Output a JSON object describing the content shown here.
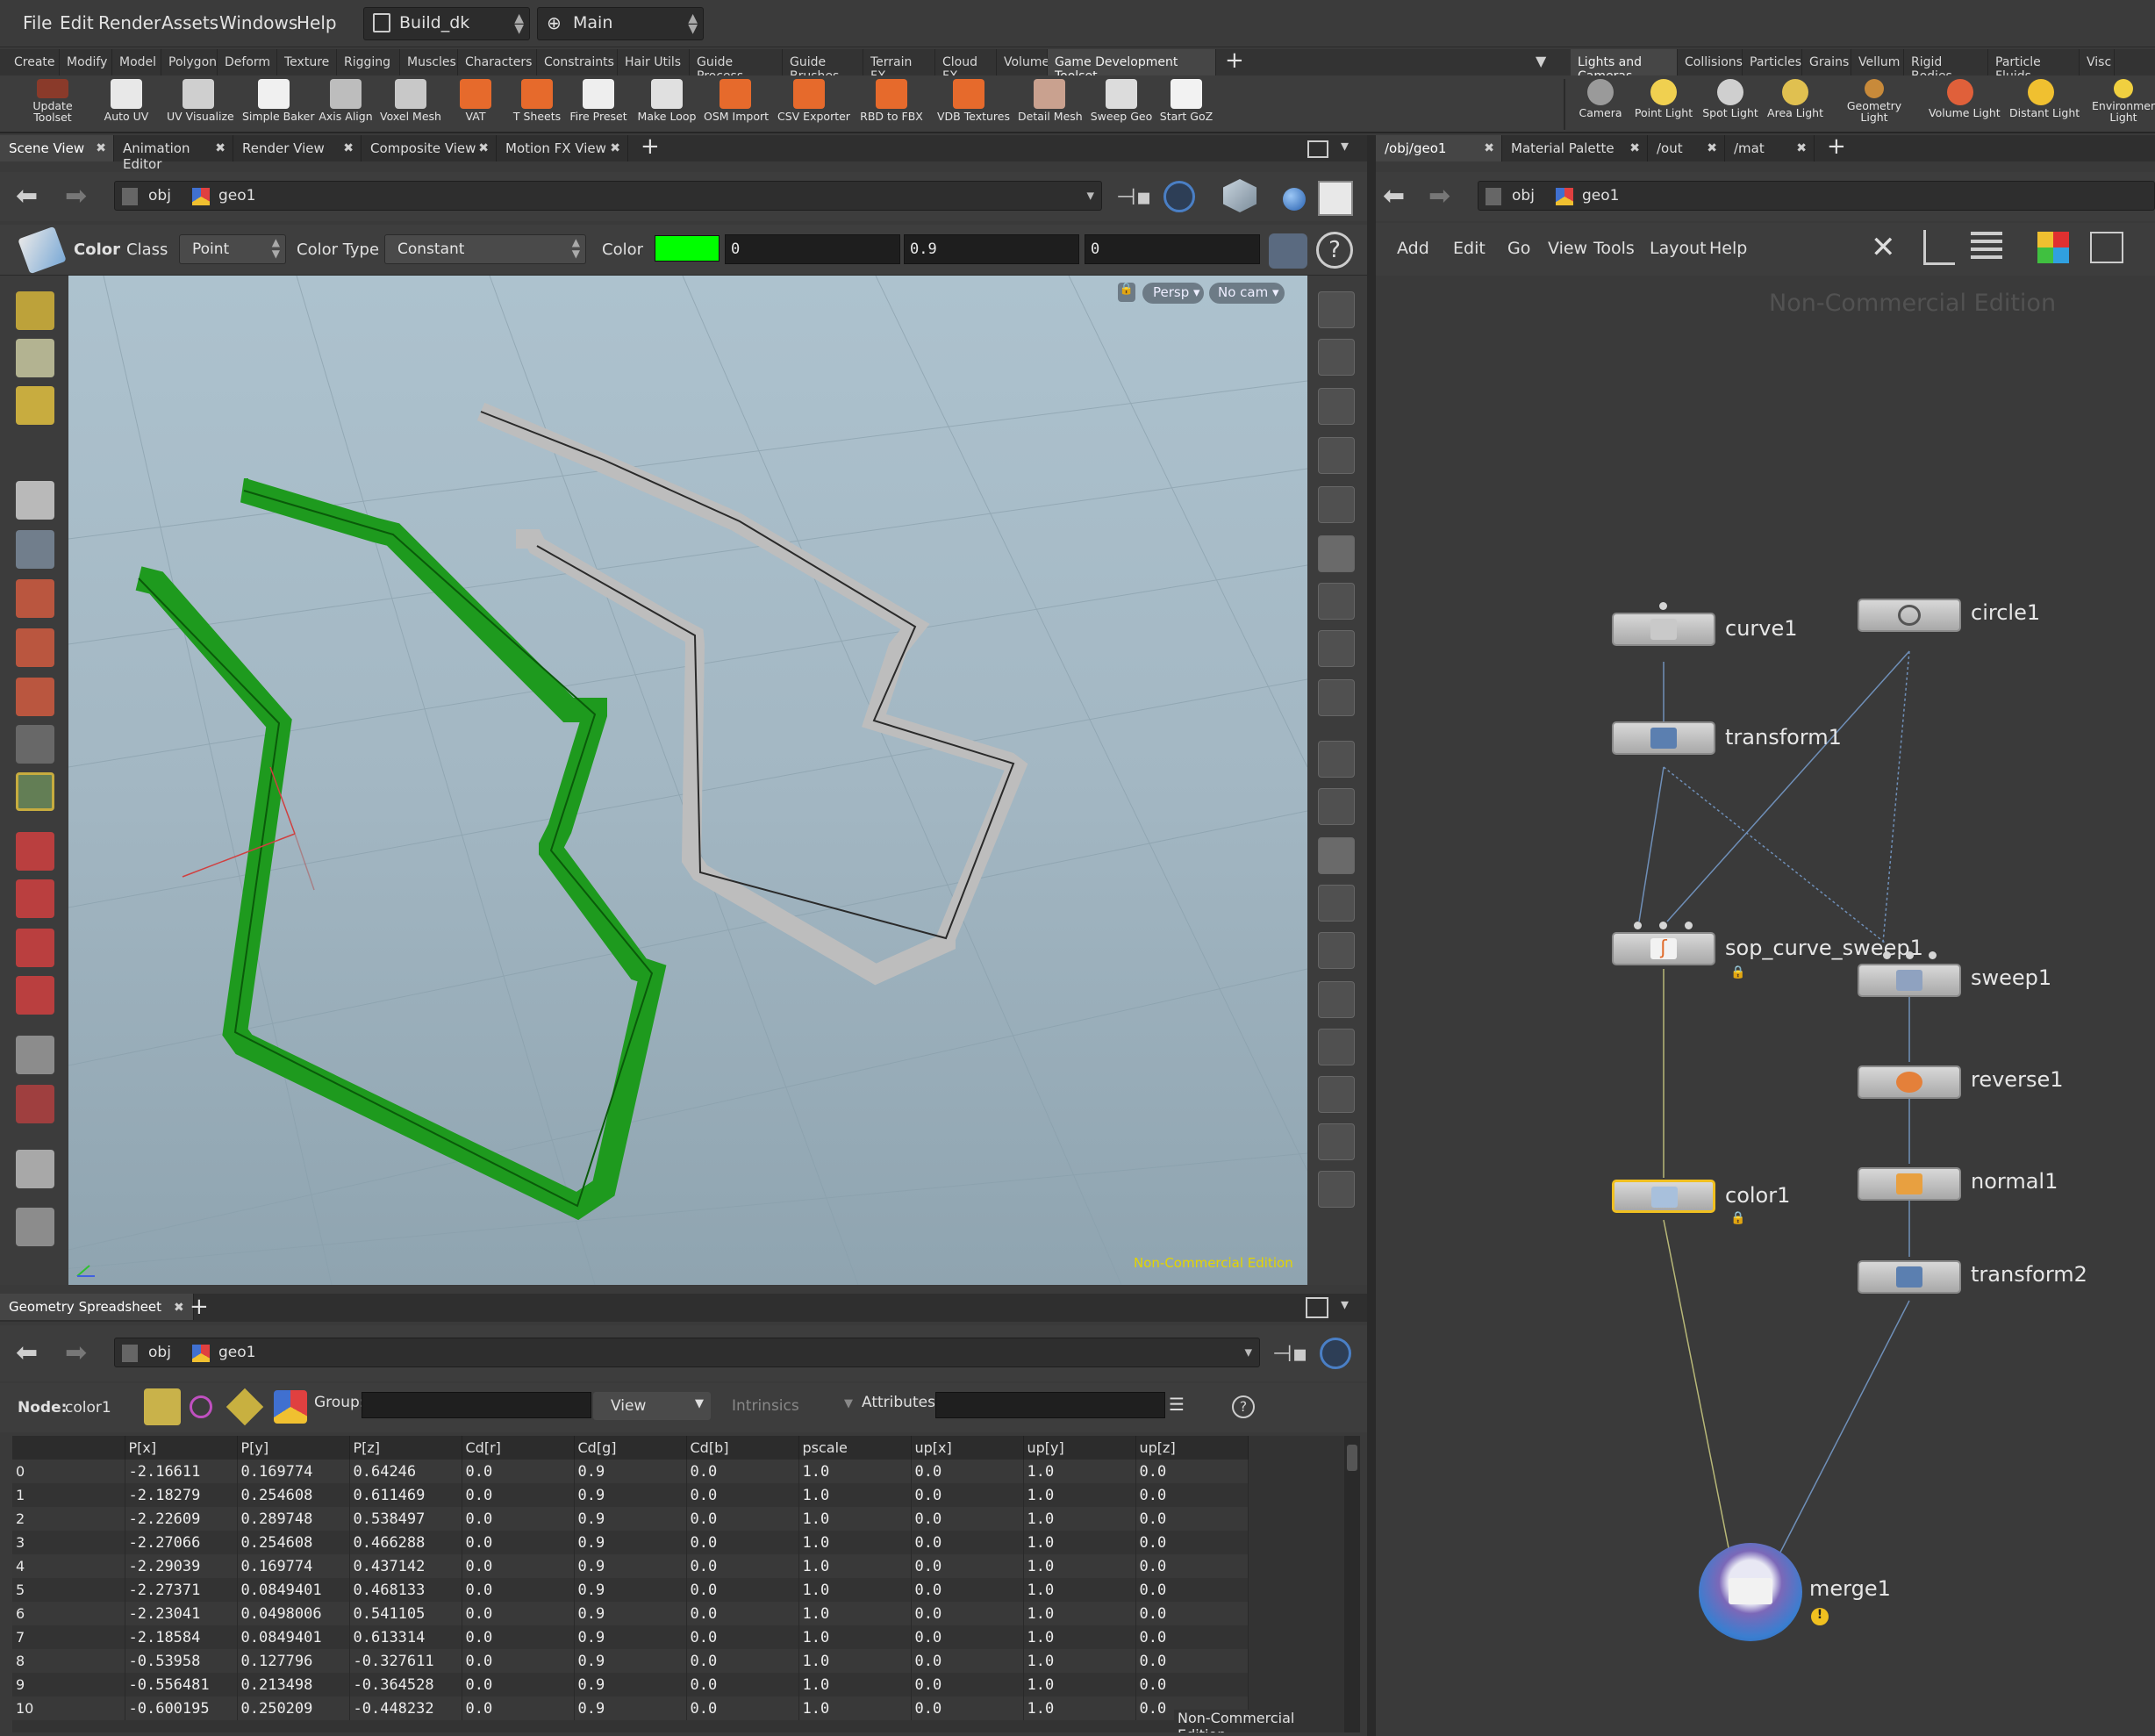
{
  "menubar": {
    "items": [
      "File",
      "Edit",
      "Render",
      "Assets",
      "Windows",
      "Help"
    ],
    "desktop": "Build_dk",
    "context": "Main"
  },
  "shelf_tabs_left": [
    "Create",
    "Modify",
    "Model",
    "Polygon",
    "Deform",
    "Texture",
    "Rigging",
    "Muscles",
    "Characters",
    "Constraints",
    "Hair Utils",
    "Guide Process",
    "Guide Brushes",
    "Terrain FX",
    "Cloud FX",
    "Volume",
    "Game Development Toolset"
  ],
  "shelf_tabs_right": [
    "Lights and Cameras",
    "Collisions",
    "Particles",
    "Grains",
    "Vellum",
    "Rigid Bodies",
    "Particle Fluids",
    "Visc"
  ],
  "shelf_tools_left": [
    {
      "label": "Update\nToolset",
      "icon": "update-toolset-icon",
      "color": "#8a3a2a"
    },
    {
      "label": "Auto UV",
      "icon": "auto-uv-icon",
      "color": "#e8e8e8"
    },
    {
      "label": "UV Visualize",
      "icon": "uv-visualize-icon",
      "color": "#cfcfcf"
    },
    {
      "label": "Simple Baker",
      "icon": "simple-baker-icon",
      "color": "#f0f0f0"
    },
    {
      "label": "Axis Align",
      "icon": "axis-align-icon",
      "color": "#bdbdbd"
    },
    {
      "label": "Voxel Mesh",
      "icon": "voxel-mesh-icon",
      "color": "#c8c8c8"
    },
    {
      "label": "VAT",
      "icon": "vat-icon",
      "color": "#e66a2c"
    },
    {
      "label": "T Sheets",
      "icon": "t-sheets-icon",
      "color": "#e66a2c"
    },
    {
      "label": "Fire Preset",
      "icon": "fire-preset-icon",
      "color": "#eeeeee"
    },
    {
      "label": "Make Loop",
      "icon": "make-loop-icon",
      "color": "#e0e0e0"
    },
    {
      "label": "OSM Import",
      "icon": "osm-import-icon",
      "color": "#e66a2c"
    },
    {
      "label": "CSV Exporter",
      "icon": "csv-exporter-icon",
      "color": "#e66a2c"
    },
    {
      "label": "RBD to FBX",
      "icon": "rbd-to-fbx-icon",
      "color": "#e66a2c"
    },
    {
      "label": "VDB Textures",
      "icon": "vdb-textures-icon",
      "color": "#e66a2c"
    },
    {
      "label": "Detail Mesh",
      "icon": "detail-mesh-icon",
      "color": "#c9a18f"
    },
    {
      "label": "Sweep Geo",
      "icon": "sweep-geo-icon",
      "color": "#dcdcdc"
    },
    {
      "label": "Start GoZ",
      "icon": "start-goz-icon",
      "color": "#f2f2f2"
    }
  ],
  "shelf_tools_right": [
    {
      "label": "Camera",
      "icon": "camera-icon",
      "color": "#9a9a9a"
    },
    {
      "label": "Point Light",
      "icon": "point-light-icon",
      "color": "#f0d050"
    },
    {
      "label": "Spot Light",
      "icon": "spot-light-icon",
      "color": "#cfcfcf"
    },
    {
      "label": "Area Light",
      "icon": "area-light-icon",
      "color": "#e0c050"
    },
    {
      "label": "Geometry\nLight",
      "icon": "geometry-light-icon",
      "color": "#c88a3a"
    },
    {
      "label": "Volume Light",
      "icon": "volume-light-icon",
      "color": "#e0603a"
    },
    {
      "label": "Distant Light",
      "icon": "distant-light-icon",
      "color": "#f0c030"
    },
    {
      "label": "Environment\nLight",
      "icon": "environment-light-icon",
      "color": "#f0d040"
    }
  ],
  "left_pane_tabs": [
    "Scene View",
    "Animation Editor",
    "Render View",
    "Composite View",
    "Motion FX View"
  ],
  "right_pane_tabs": [
    "/obj/geo1",
    "Material Palette",
    "/out",
    "/mat"
  ],
  "path": {
    "root": "obj",
    "node": "geo1"
  },
  "color_op": {
    "title": "Color",
    "class_label": "Class",
    "class_value": "Point",
    "color_type_label": "Color Type",
    "color_type_value": "Constant",
    "color_label": "Color",
    "r": "0",
    "g": "0.9",
    "b": "0",
    "swatch": "#00ff00"
  },
  "viewport": {
    "persp": "Persp",
    "cam": "No cam",
    "watermark": "Non-Commercial Edition",
    "green_curve_color": "#1e9a1e",
    "gray_curve_color": "#bdbdbd"
  },
  "network": {
    "menu": [
      "Add",
      "Edit",
      "Go",
      "View",
      "Tools",
      "Layout",
      "Help"
    ],
    "watermark": "Non-Commercial Edition",
    "nodes": [
      {
        "name": "curve1",
        "icon": "curve-icon"
      },
      {
        "name": "circle1",
        "icon": "circle-icon"
      },
      {
        "name": "transform1",
        "icon": "transform-icon"
      },
      {
        "name": "sop_curve_sweep1",
        "icon": "sweep-hda-icon"
      },
      {
        "name": "sweep1",
        "icon": "sweep-icon"
      },
      {
        "name": "reverse1",
        "icon": "reverse-icon"
      },
      {
        "name": "normal1",
        "icon": "normal-icon"
      },
      {
        "name": "color1",
        "icon": "color-icon"
      },
      {
        "name": "transform2",
        "icon": "transform-icon"
      },
      {
        "name": "merge1",
        "icon": "merge-icon"
      }
    ]
  },
  "spreadsheet": {
    "tab": "Geometry Spreadsheet",
    "node_label": "Node:",
    "node_value": "color1",
    "group_label": "Group:",
    "view_label": "View",
    "intrinsics_label": "Intrinsics",
    "attributes_label": "Attributes:",
    "watermark": "Non-Commercial Edition",
    "columns": [
      "",
      "P[x]",
      "P[y]",
      "P[z]",
      "Cd[r]",
      "Cd[g]",
      "Cd[b]",
      "pscale",
      "up[x]",
      "up[y]",
      "up[z]"
    ],
    "rows": [
      [
        "0",
        "-2.16611",
        "0.169774",
        "0.64246",
        "0.0",
        "0.9",
        "0.0",
        "1.0",
        "0.0",
        "1.0",
        "0.0"
      ],
      [
        "1",
        "-2.18279",
        "0.254608",
        "0.611469",
        "0.0",
        "0.9",
        "0.0",
        "1.0",
        "0.0",
        "1.0",
        "0.0"
      ],
      [
        "2",
        "-2.22609",
        "0.289748",
        "0.538497",
        "0.0",
        "0.9",
        "0.0",
        "1.0",
        "0.0",
        "1.0",
        "0.0"
      ],
      [
        "3",
        "-2.27066",
        "0.254608",
        "0.466288",
        "0.0",
        "0.9",
        "0.0",
        "1.0",
        "0.0",
        "1.0",
        "0.0"
      ],
      [
        "4",
        "-2.29039",
        "0.169774",
        "0.437142",
        "0.0",
        "0.9",
        "0.0",
        "1.0",
        "0.0",
        "1.0",
        "0.0"
      ],
      [
        "5",
        "-2.27371",
        "0.0849401",
        "0.468133",
        "0.0",
        "0.9",
        "0.0",
        "1.0",
        "0.0",
        "1.0",
        "0.0"
      ],
      [
        "6",
        "-2.23041",
        "0.0498006",
        "0.541105",
        "0.0",
        "0.9",
        "0.0",
        "1.0",
        "0.0",
        "1.0",
        "0.0"
      ],
      [
        "7",
        "-2.18584",
        "0.0849401",
        "0.613314",
        "0.0",
        "0.9",
        "0.0",
        "1.0",
        "0.0",
        "1.0",
        "0.0"
      ],
      [
        "8",
        "-0.53958",
        "0.127796",
        "-0.327611",
        "0.0",
        "0.9",
        "0.0",
        "1.0",
        "0.0",
        "1.0",
        "0.0"
      ],
      [
        "9",
        "-0.556481",
        "0.213498",
        "-0.364528",
        "0.0",
        "0.9",
        "0.0",
        "1.0",
        "0.0",
        "1.0",
        "0.0"
      ],
      [
        "10",
        "-0.600195",
        "0.250209",
        "-0.448232",
        "0.0",
        "0.9",
        "0.0",
        "1.0",
        "0.0",
        "1.0",
        "0.0"
      ]
    ]
  }
}
